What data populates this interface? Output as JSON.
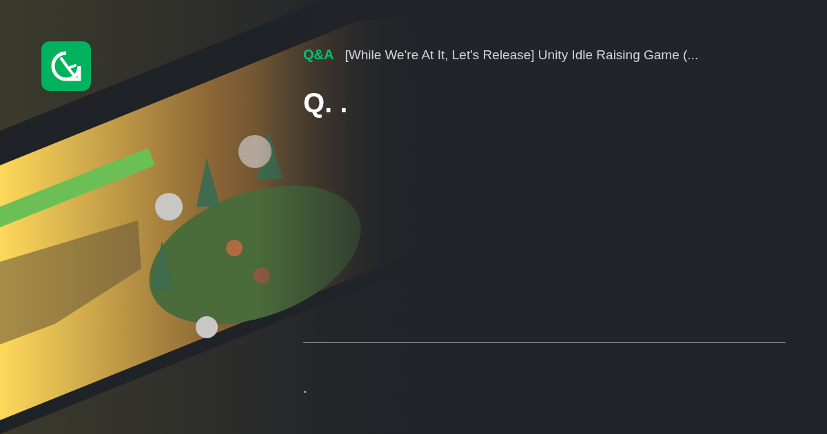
{
  "header": {
    "category": "Q&A",
    "course_title": "[While We're At It, Let's Release] Unity Idle Raising Game (..."
  },
  "question_title": "Q. .",
  "question_body": "."
}
